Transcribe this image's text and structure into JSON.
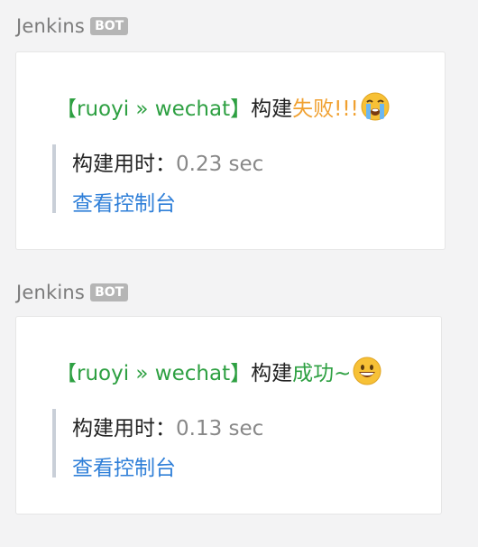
{
  "messages": [
    {
      "sender": "Jenkins",
      "badge": "BOT",
      "repo": "【ruoyi » wechat】",
      "build_word": "构建",
      "status_text": "失败!!!",
      "status": "fail",
      "status_color": "#f0a030",
      "emoji": "loudly-crying-face-icon",
      "duration_label": "构建用时：",
      "duration_value": "0.23 sec",
      "console_link": "查看控制台"
    },
    {
      "sender": "Jenkins",
      "badge": "BOT",
      "repo": "【ruoyi » wechat】",
      "build_word": "构建",
      "status_text": "成功~",
      "status": "success",
      "status_color": "#2ea042",
      "emoji": "grinning-face-icon",
      "duration_label": "构建用时：",
      "duration_value": "0.13 sec",
      "console_link": "查看控制台"
    }
  ]
}
